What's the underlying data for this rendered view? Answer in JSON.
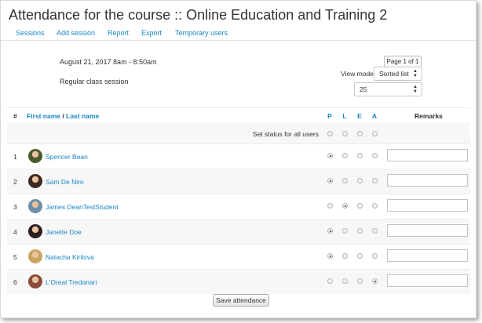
{
  "page_title": "Attendance for the course :: Online Education and Training 2",
  "tabs": [
    "Sessions",
    "Add session",
    "Report",
    "Export",
    "Temporary users"
  ],
  "session": {
    "datetime": "August 21, 2017 8am - 8:50am",
    "description": "Regular class session"
  },
  "pager": {
    "label": "Page 1 of 1"
  },
  "view_mode": {
    "label": "View mode",
    "selected": "Sorted list"
  },
  "per_page": {
    "selected": "25"
  },
  "table": {
    "headers": {
      "num": "#",
      "first_name": "First name",
      "separator": "/",
      "last_name": "Last name",
      "statuses": [
        "P",
        "L",
        "E",
        "A"
      ],
      "remarks": "Remarks"
    },
    "set_status_label": "Set status for all users",
    "rows": [
      {
        "num": "1",
        "name": "Spencer Bean",
        "status": "P",
        "avatar_color": "#4a5a2c"
      },
      {
        "num": "2",
        "name": "Sam De Niro",
        "status": "P",
        "avatar_color": "#3b2a22"
      },
      {
        "num": "3",
        "name": "James DeanTestStudent",
        "status": "L",
        "avatar_color": "#6f8fa8"
      },
      {
        "num": "4",
        "name": "Janette Doe",
        "status": "P",
        "avatar_color": "#2b1f22"
      },
      {
        "num": "5",
        "name": "Natacha Kirilova",
        "status": "P",
        "avatar_color": "#c9a55e"
      },
      {
        "num": "6",
        "name": "L'Oreal Tredanari",
        "status": "A",
        "avatar_color": "#8a4b3a"
      }
    ]
  },
  "save_button": "Save attendance",
  "colors": {
    "link": "#1a85c6",
    "text": "#333333"
  }
}
